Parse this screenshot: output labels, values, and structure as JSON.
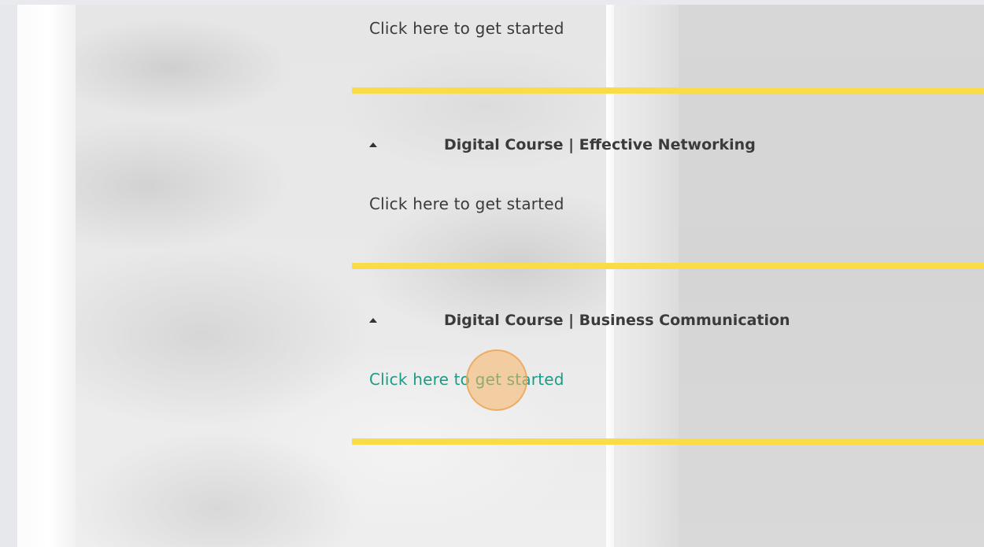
{
  "sections": [
    {
      "title": "",
      "link_text": "Click here to get started"
    },
    {
      "title": "Digital Course | Effective Networking",
      "link_text": "Click here to get started"
    },
    {
      "title": "Digital Course | Business Communication",
      "link_text": "Click here to get started"
    }
  ],
  "icons": {
    "caret": "caret-up-icon"
  },
  "colors": {
    "divider": "#fbdc48",
    "link_active": "#1b9c84",
    "text": "#3a3a3a",
    "click_marker": "#f5b464"
  }
}
